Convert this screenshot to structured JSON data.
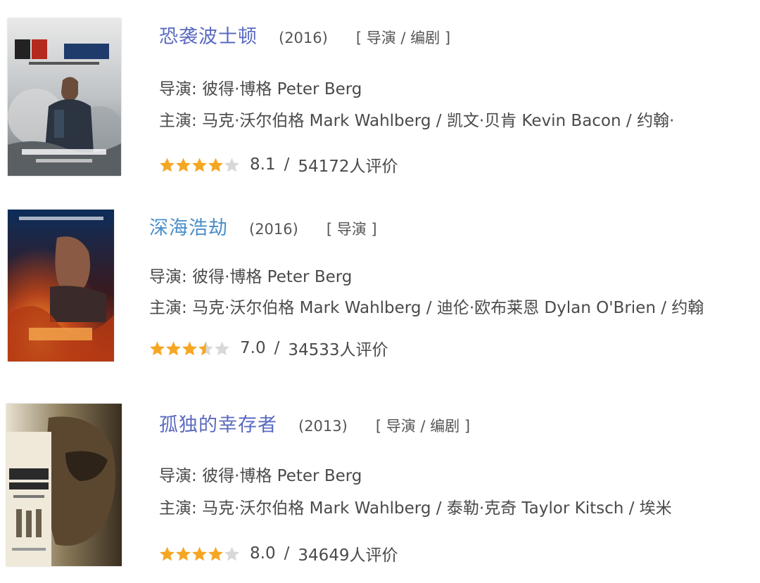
{
  "colors": {
    "title_link": "#5a72c4",
    "star_filled": "#f5a623",
    "star_empty": "#d8d8d8"
  },
  "labels": {
    "director_prefix": "导演:",
    "cast_prefix": "主演:",
    "separator": "/"
  },
  "movies": [
    {
      "title": "恐袭波士顿",
      "year": "(2016)",
      "roles": "[ 导演 / 编剧 ]",
      "director": "彼得·博格 Peter Berg",
      "cast": "马克·沃尔伯格 Mark Wahlberg / 凯文·贝肯 Kevin Bacon / 约翰·",
      "rating": "8.1",
      "stars": 4,
      "votes": "54172人评价",
      "poster_text": "恐袭波士顿"
    },
    {
      "title": "深海浩劫",
      "year": "(2016)",
      "roles": "[ 导演 ]",
      "director": "彼得·博格 Peter Berg",
      "cast": "马克·沃尔伯格 Mark Wahlberg / 迪伦·欧布莱恩 Dylan O'Brien / 约翰",
      "rating": "7.0",
      "stars": 3.5,
      "votes": "34533人评价",
      "poster_text": "深海浩劫"
    },
    {
      "title": "孤独的幸存者",
      "year": "(2013)",
      "roles": "[ 导演 / 编剧 ]",
      "director": "彼得·博格 Peter Berg",
      "cast": "马克·沃尔伯格 Mark Wahlberg / 泰勒·克奇 Taylor Kitsch / 埃米",
      "rating": "8.0",
      "stars": 4,
      "votes": "34649人评价",
      "poster_text": "LONE SURVIVOR"
    }
  ]
}
